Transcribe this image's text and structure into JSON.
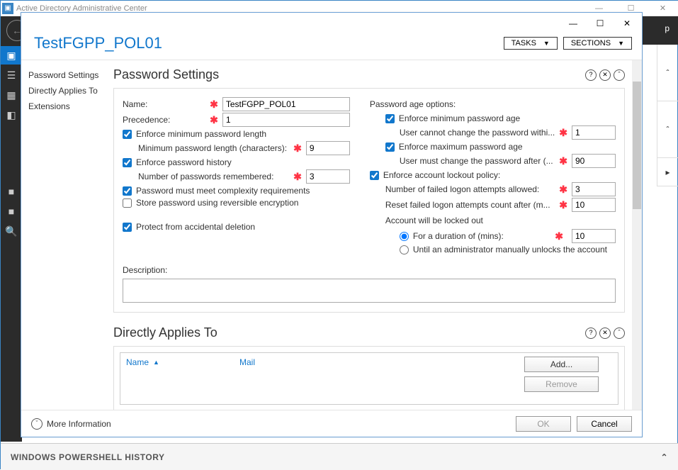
{
  "main_window": {
    "title": "Active Directory Administrative Center",
    "help_label": "p"
  },
  "ps_history": {
    "label": "WINDOWS POWERSHELL HISTORY"
  },
  "dialog": {
    "title": "TestFGPP_POL01",
    "buttons": {
      "tasks": "TASKS",
      "sections": "SECTIONS"
    },
    "nav": {
      "pw": "Password Settings",
      "dat": "Directly Applies To",
      "ext": "Extensions"
    }
  },
  "ps": {
    "title": "Password Settings",
    "name_label": "Name:",
    "name_value": "TestFGPP_POL01",
    "prec_label": "Precedence:",
    "prec_value": "1",
    "minlen_chk": "Enforce minimum password length",
    "minlen_label": "Minimum password length (characters):",
    "minlen_value": "9",
    "hist_chk": "Enforce password history",
    "hist_label": "Number of passwords remembered:",
    "hist_value": "3",
    "complex_chk": "Password must meet complexity requirements",
    "reverse_chk": "Store password using reversible encryption",
    "protect_chk": "Protect from accidental deletion",
    "desc_label": "Description:",
    "age_label": "Password age options:",
    "minage_chk": "Enforce minimum password age",
    "minage_label": "User cannot change the password withi...",
    "minage_value": "1",
    "maxage_chk": "Enforce maximum password age",
    "maxage_label": "User must change the password after (...",
    "maxage_value": "90",
    "lockout_chk": "Enforce account lockout policy:",
    "fail_label": "Number of failed logon attempts allowed:",
    "fail_value": "3",
    "reset_label": "Reset failed logon attempts count after (m...",
    "reset_value": "10",
    "acct_locked_label": "Account will be locked out",
    "dur_radio": "For a duration of (mins):",
    "dur_value": "10",
    "admin_radio": "Until an administrator manually unlocks the account"
  },
  "dat": {
    "title": "Directly Applies To",
    "col_name": "Name",
    "col_mail": "Mail",
    "add": "Add...",
    "remove": "Remove"
  },
  "footer": {
    "more": "More Information",
    "ok": "OK",
    "cancel": "Cancel"
  }
}
